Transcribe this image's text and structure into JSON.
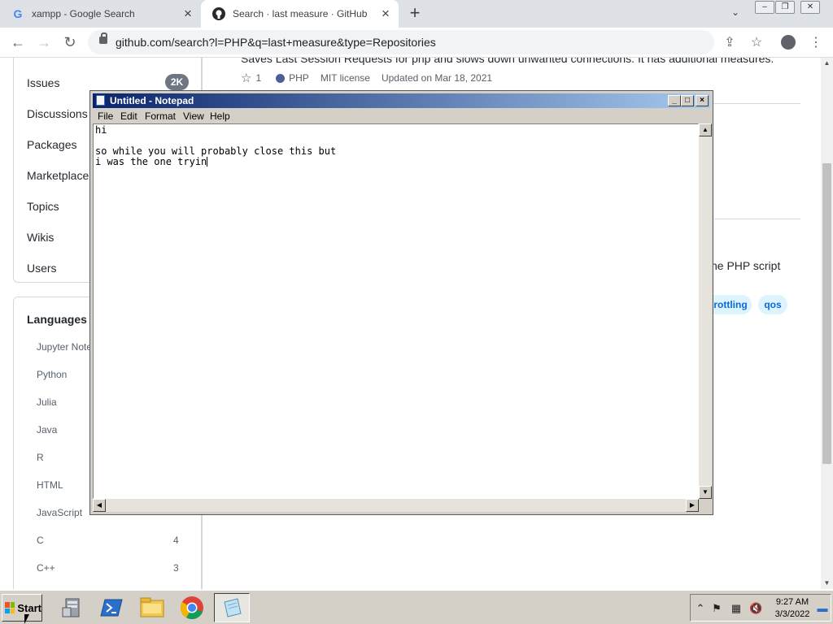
{
  "browser": {
    "tabs": [
      {
        "title": "xampp - Google Search",
        "favicon": "google-g-icon",
        "active": false
      },
      {
        "title": "Search · last measure · GitHub",
        "favicon": "github-icon",
        "active": true
      }
    ],
    "url": "github.com/search?l=PHP&q=last+measure&type=Repositories"
  },
  "github": {
    "nav": [
      {
        "label": "Issues",
        "count": "2K"
      },
      {
        "label": "Discussions"
      },
      {
        "label": "Packages"
      },
      {
        "label": "Marketplace"
      },
      {
        "label": "Topics"
      },
      {
        "label": "Wikis"
      },
      {
        "label": "Users"
      }
    ],
    "languages_heading": "Languages",
    "languages": [
      {
        "name": "Jupyter Note",
        "count": ""
      },
      {
        "name": "Python",
        "count": ""
      },
      {
        "name": "Julia",
        "count": ""
      },
      {
        "name": "Java",
        "count": ""
      },
      {
        "name": "R",
        "count": ""
      },
      {
        "name": "HTML",
        "count": ""
      },
      {
        "name": "JavaScript",
        "count": ""
      },
      {
        "name": "C",
        "count": "4"
      },
      {
        "name": "C++",
        "count": "3"
      }
    ],
    "result": {
      "description": "Saves Last Session Requests for php and slows down unwanted connections. It has additional measures.",
      "stars": "1",
      "language": "PHP",
      "language_color": "#4f5d95",
      "license": "MIT license",
      "updated": "Updated on Mar 18, 2021"
    },
    "snippet": "he PHP script",
    "topics": [
      "rottling",
      "qos"
    ]
  },
  "notepad": {
    "title": "Untitled - Notepad",
    "menu": [
      "File",
      "Edit",
      "Format",
      "View",
      "Help"
    ],
    "text": "hi\n\nso while you will probably close this but\ni was the one tryin"
  },
  "taskbar": {
    "start_label": "Start",
    "apps": [
      "server-manager-icon",
      "powershell-icon",
      "file-explorer-icon",
      "chrome-icon",
      "notepad-icon"
    ],
    "clock_time": "9:27 AM",
    "clock_date": "3/3/2022"
  }
}
